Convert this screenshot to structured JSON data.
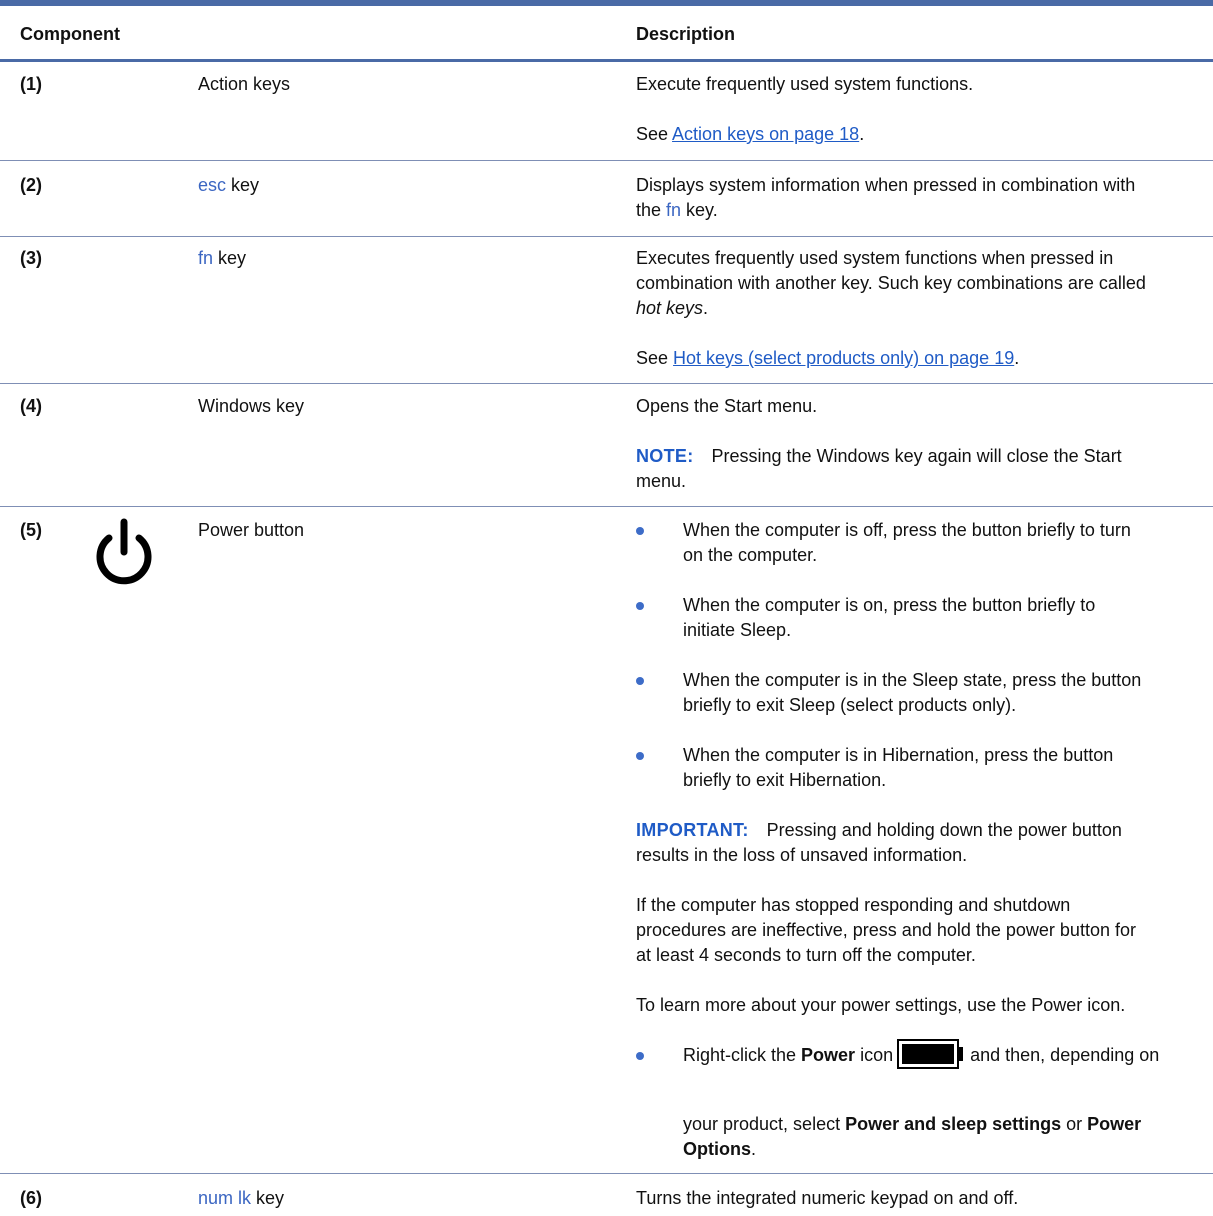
{
  "header": {
    "component": "Component",
    "description": "Description"
  },
  "rows": [
    {
      "num": "(1)",
      "name": "Action keys",
      "desc": [
        "Execute frequently used system functions."
      ],
      "see_prefix": "See ",
      "see_link": "Action keys on page 18",
      "see_suffix": "."
    },
    {
      "num": "(2)",
      "name_key": "esc",
      "name_rest": " key",
      "desc_line1": "Displays system information when pressed in combination with",
      "desc_line2_prefix": "the ",
      "desc_line2_key": "fn",
      "desc_line2_suffix": " key."
    },
    {
      "num": "(3)",
      "name_key": "fn",
      "name_rest": " key",
      "desc": [
        "Executes frequently used system functions when pressed in",
        "combination with another key. Such key combinations are called"
      ],
      "desc_italic": "hot keys",
      "desc_italic_suffix": ".",
      "see_prefix": "See ",
      "see_link": "Hot keys (select products only) on page 19",
      "see_suffix": "."
    },
    {
      "num": "(4)",
      "name": "Windows key",
      "desc": [
        "Opens the Start menu."
      ],
      "note_label": "NOTE:",
      "note_text": "Pressing the Windows key again will close the Start",
      "note_text2": "menu."
    },
    {
      "num": "(5)",
      "icon": "power-icon",
      "name": "Power button",
      "bullets": [
        [
          "When the computer is off, press the button briefly to turn",
          "on the computer."
        ],
        [
          "When the computer is on, press the button briefly to",
          "initiate Sleep."
        ],
        [
          "When the computer is in the Sleep state, press the button",
          "briefly to exit Sleep (select products only)."
        ],
        [
          "When the computer is in Hibernation, press the button",
          "briefly to exit Hibernation."
        ]
      ],
      "important_label": "IMPORTANT:",
      "important_text": "Pressing and holding down the power button",
      "important_text2": "results in the loss of unsaved information.",
      "para1": [
        "If the computer has stopped responding and shutdown",
        "procedures are ineffective, press and hold the power button for",
        "at least 4 seconds to turn off the computer."
      ],
      "para2": "To learn more about your power settings, use the Power icon.",
      "last_bullet": {
        "pre": "Right-click the ",
        "bold1": "Power",
        "mid": " icon",
        "icon": "battery-icon",
        "post": " and then, depending on",
        "line2_pre": "your product, select ",
        "bold2": "Power and sleep settings",
        "line2_mid": " or ",
        "bold3a": "Power",
        "bold3b": "Options",
        "end": "."
      }
    },
    {
      "num": "(6)",
      "name_key": "num lk",
      "name_rest": " key",
      "desc": [
        "Turns the integrated numeric keypad on and off."
      ]
    }
  ]
}
